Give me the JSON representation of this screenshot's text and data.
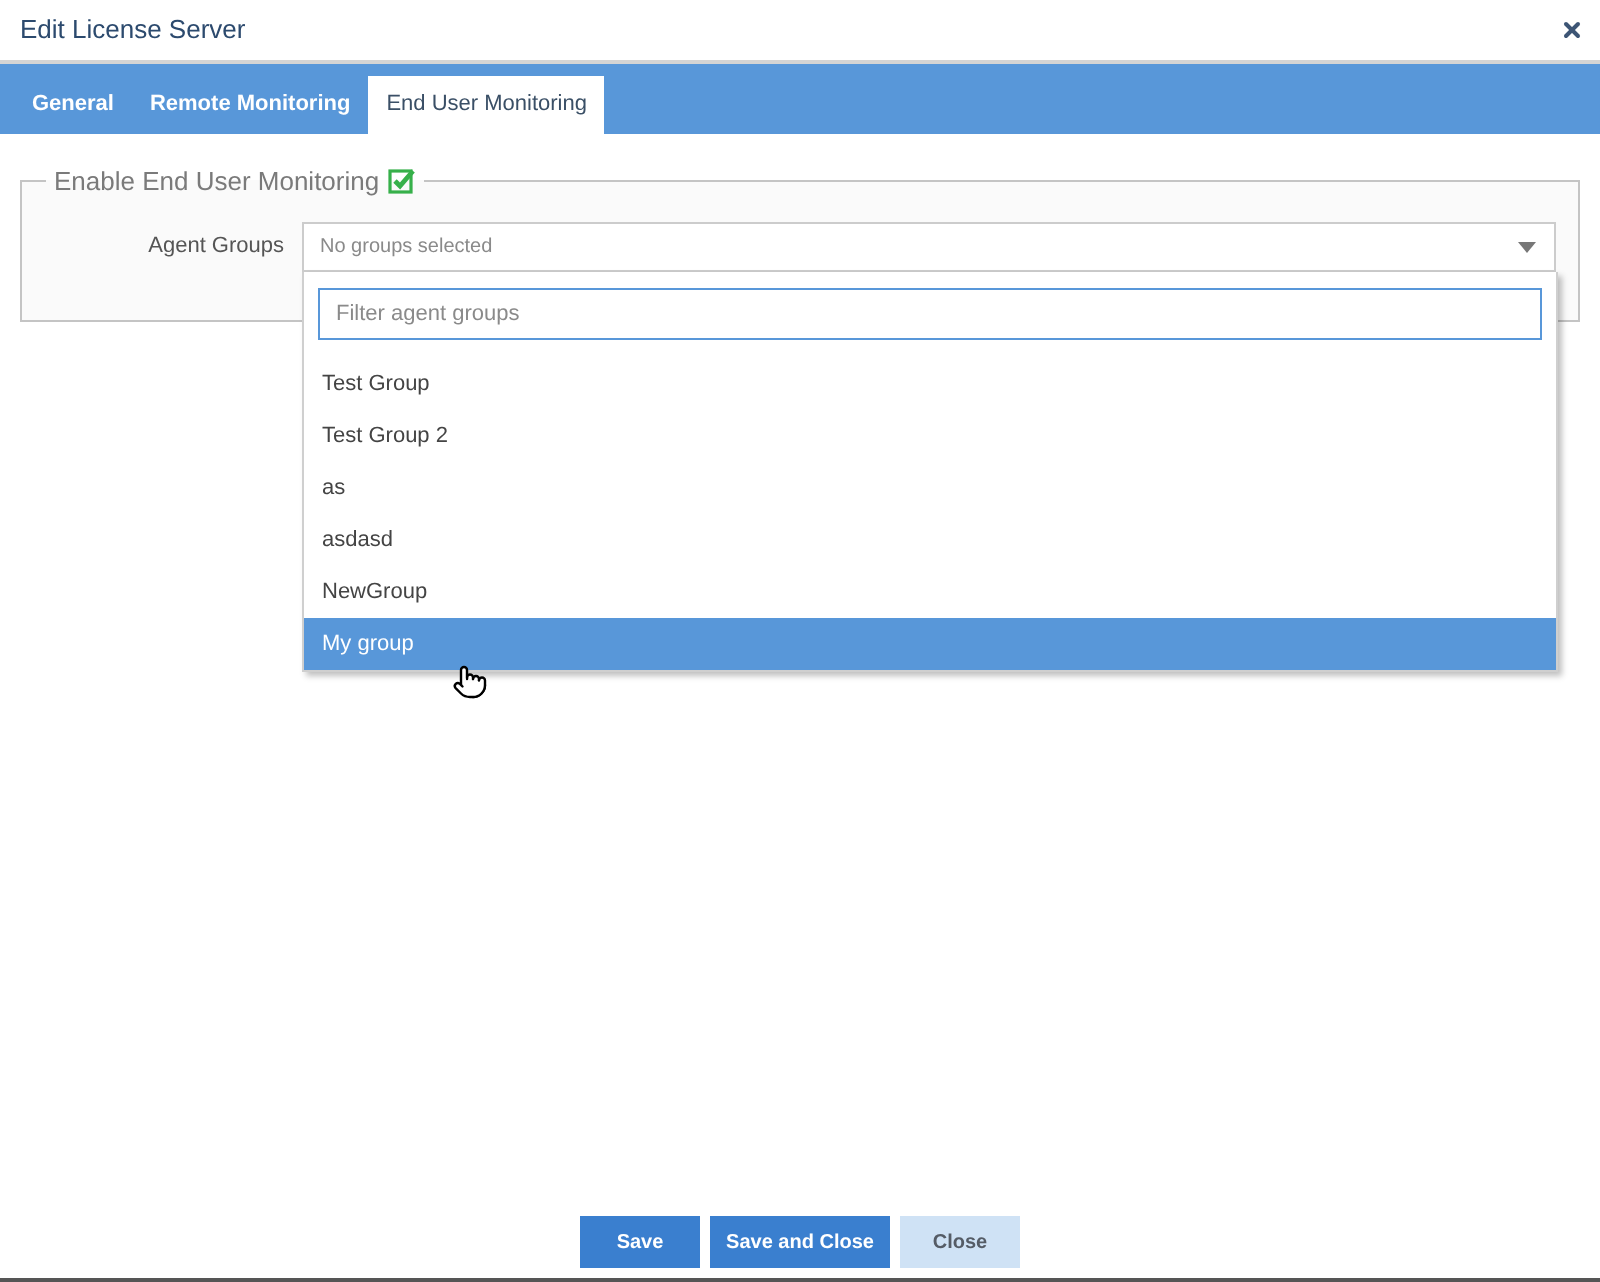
{
  "dialog": {
    "title": "Edit License Server"
  },
  "tabs": [
    {
      "label": "General",
      "selected": false
    },
    {
      "label": "Remote Monitoring",
      "selected": false
    },
    {
      "label": "End User Monitoring",
      "selected": true
    }
  ],
  "section": {
    "legend": "Enable End User Monitoring",
    "checked": true
  },
  "agent_groups": {
    "label": "Agent Groups",
    "value": "No groups selected",
    "expanded": true,
    "filter": {
      "placeholder": "Filter agent groups"
    },
    "options": [
      {
        "label": "Test Group",
        "selected": false
      },
      {
        "label": "Test Group 2",
        "selected": false
      },
      {
        "label": "as",
        "selected": false
      },
      {
        "label": "asdasd",
        "selected": false
      },
      {
        "label": "NewGroup",
        "selected": false
      },
      {
        "label": "My group",
        "selected": true
      }
    ]
  },
  "buttons": [
    {
      "label": "Save",
      "kind": "primary"
    },
    {
      "label": "Save and Close",
      "kind": "primary"
    },
    {
      "label": "Close",
      "kind": "secondary"
    }
  ]
}
